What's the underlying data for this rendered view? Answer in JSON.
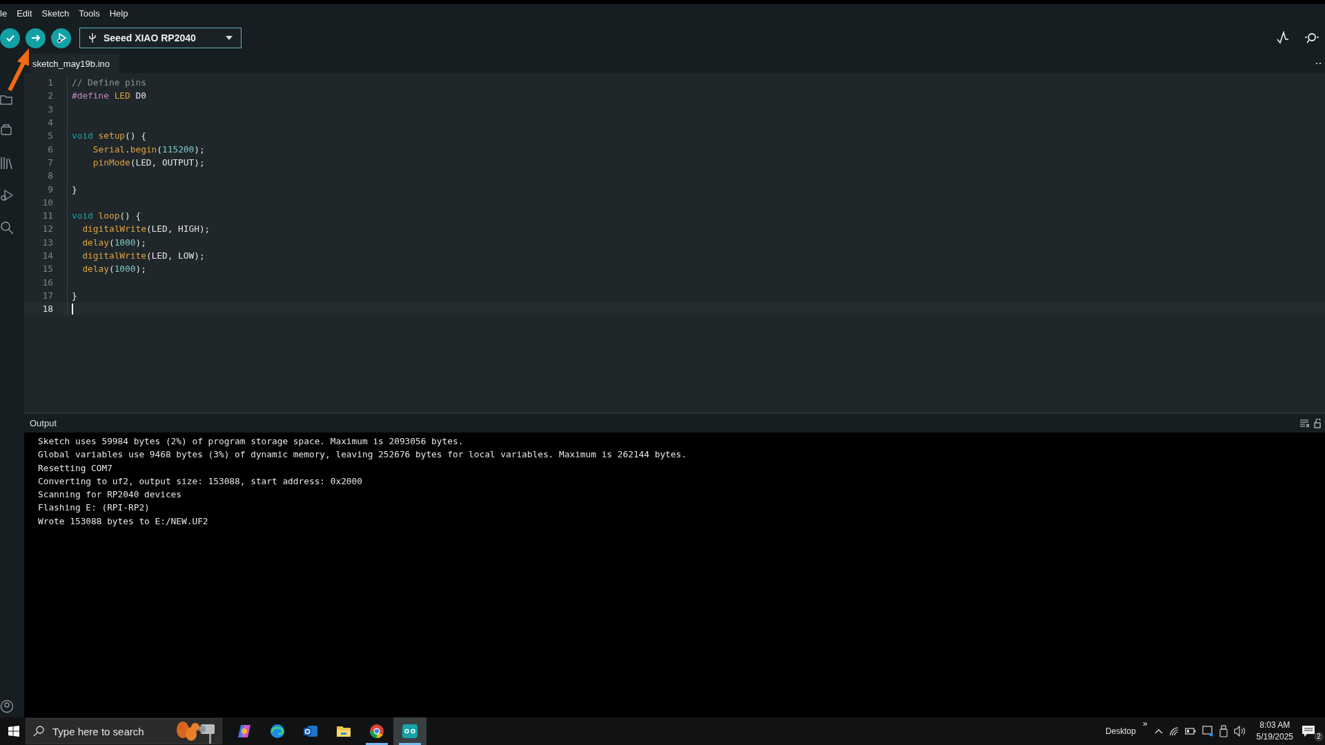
{
  "menu": [
    {
      "label": "le"
    },
    {
      "label": "Edit"
    },
    {
      "label": "Sketch"
    },
    {
      "label": "Tools"
    },
    {
      "label": "Help"
    }
  ],
  "toolbar": {
    "buttons": [
      {
        "kind": "verify"
      },
      {
        "kind": "upload"
      },
      {
        "kind": "debug"
      }
    ],
    "board": {
      "label": "Seeed XIAO RP2040"
    }
  },
  "tabs": [
    {
      "label": "sketch_may19b.ino",
      "selected": true
    }
  ],
  "editor": {
    "lines": [
      {
        "number": "1",
        "selected": false,
        "tokens": [
          {
            "kind": "comment",
            "text": "// Define pins"
          }
        ]
      },
      {
        "number": "2",
        "selected": false,
        "tokens": [
          {
            "kind": "macro",
            "text": "#define "
          },
          {
            "kind": "func",
            "text": "LED"
          },
          {
            "kind": "plain",
            "text": " D0"
          }
        ]
      },
      {
        "number": "3",
        "selected": false
      },
      {
        "number": "4",
        "selected": false
      },
      {
        "number": "5",
        "selected": false,
        "tokens": [
          {
            "kind": "keyword",
            "text": "void "
          },
          {
            "kind": "func",
            "text": "setup"
          },
          {
            "kind": "plain",
            "text": "() {"
          }
        ]
      },
      {
        "number": "6",
        "selected": false,
        "tokens": [
          {
            "kind": "func",
            "text": "    Serial"
          },
          {
            "kind": "plain",
            "text": "."
          },
          {
            "kind": "func",
            "text": "begin"
          },
          {
            "kind": "plain",
            "text": "("
          },
          {
            "kind": "number",
            "text": "115200"
          },
          {
            "kind": "plain",
            "text": ");"
          }
        ]
      },
      {
        "number": "7",
        "selected": false,
        "tokens": [
          {
            "kind": "func",
            "text": "    pinMode"
          },
          {
            "kind": "plain",
            "text": "(LED, OUTPUT);"
          }
        ]
      },
      {
        "number": "8",
        "selected": false
      },
      {
        "number": "9",
        "selected": false,
        "tokens": [
          {
            "kind": "plain",
            "text": "}"
          }
        ]
      },
      {
        "number": "10",
        "selected": false
      },
      {
        "number": "11",
        "selected": false,
        "tokens": [
          {
            "kind": "keyword",
            "text": "void "
          },
          {
            "kind": "func",
            "text": "loop"
          },
          {
            "kind": "plain",
            "text": "() {"
          }
        ]
      },
      {
        "number": "12",
        "selected": false,
        "tokens": [
          {
            "kind": "func",
            "text": "  digitalWrite"
          },
          {
            "kind": "plain",
            "text": "(LED, HIGH);"
          }
        ]
      },
      {
        "number": "13",
        "selected": false,
        "tokens": [
          {
            "kind": "func",
            "text": "  delay"
          },
          {
            "kind": "plain",
            "text": "("
          },
          {
            "kind": "number",
            "text": "1000"
          },
          {
            "kind": "plain",
            "text": ");"
          }
        ]
      },
      {
        "number": "14",
        "selected": false,
        "tokens": [
          {
            "kind": "func",
            "text": "  digitalWrite"
          },
          {
            "kind": "plain",
            "text": "(LED, LOW);"
          }
        ]
      },
      {
        "number": "15",
        "selected": false,
        "tokens": [
          {
            "kind": "func",
            "text": "  delay"
          },
          {
            "kind": "plain",
            "text": "("
          },
          {
            "kind": "number",
            "text": "1000"
          },
          {
            "kind": "plain",
            "text": ");"
          }
        ]
      },
      {
        "number": "16",
        "selected": false
      },
      {
        "number": "17",
        "selected": false,
        "tokens": [
          {
            "kind": "plain",
            "text": "}"
          }
        ]
      },
      {
        "number": "18",
        "selected": true
      }
    ]
  },
  "output": {
    "title": "Output",
    "lines": [
      "Sketch uses 59984 bytes (2%) of program storage space. Maximum is 2093056 bytes.",
      "Global variables use 9468 bytes (3%) of dynamic memory, leaving 252676 bytes for local variables. Maximum is 262144 bytes.",
      "Resetting COM7",
      "Converting to uf2, output size: 153088, start address: 0x2000",
      "Scanning for RP2040 devices",
      "Flashing E: (RPI-RP2)",
      "Wrote 153088 bytes to E:/NEW.UF2"
    ]
  },
  "taskbar": {
    "search": {
      "placeholder": "Type here to search"
    },
    "apps": [
      {
        "kind": "copilot",
        "running": false,
        "selected": false
      },
      {
        "kind": "edge",
        "running": false,
        "selected": false
      },
      {
        "kind": "outlook",
        "running": false,
        "selected": false
      },
      {
        "kind": "explorer",
        "running": false,
        "selected": false
      },
      {
        "kind": "chrome",
        "running": true,
        "selected": false
      },
      {
        "kind": "arduino",
        "running": true,
        "selected": true
      }
    ],
    "desktop": "Desktop",
    "chevron": "»",
    "time": "8:03 AM",
    "date": "5/19/2025",
    "notifications": "2"
  }
}
